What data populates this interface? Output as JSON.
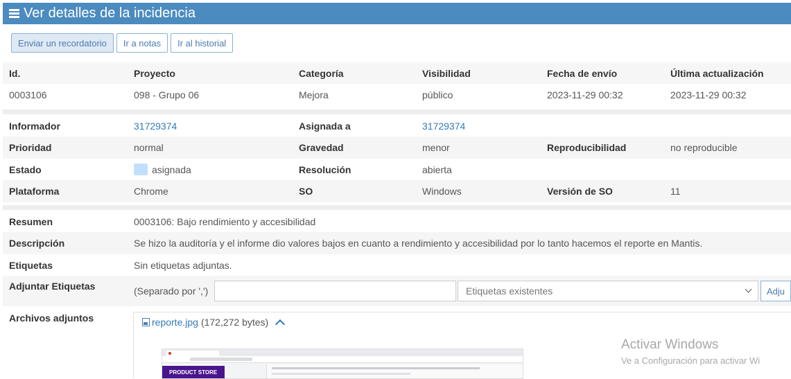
{
  "header": {
    "title": "Ver detalles de la incidencia"
  },
  "toolbar": {
    "reminder_label": "Enviar un recordatorio",
    "notes_label": "Ir a notas",
    "history_label": "Ir al historial"
  },
  "summary_table": {
    "headers": [
      "Id.",
      "Proyecto",
      "Categoría",
      "Visibilidad",
      "Fecha de envío",
      "Última actualización"
    ],
    "values": [
      "0003106",
      "098 - Grupo 06",
      "Mejora",
      "público",
      "2023-11-29 00:32",
      "2023-11-29 00:32"
    ]
  },
  "details": {
    "reporter_label": "Informador",
    "reporter_value": "31729374",
    "assigned_label": "Asignada a",
    "assigned_value": "31729374",
    "priority_label": "Prioridad",
    "priority_value": "normal",
    "severity_label": "Gravedad",
    "severity_value": "menor",
    "reproducibility_label": "Reproducibilidad",
    "reproducibility_value": "no reproducible",
    "status_label": "Estado",
    "status_value": "asignada",
    "resolution_label": "Resolución",
    "resolution_value": "abierta",
    "platform_label": "Plataforma",
    "platform_value": "Chrome",
    "os_label": "SO",
    "os_value": "Windows",
    "os_version_label": "Versión de SO",
    "os_version_value": "11"
  },
  "description": {
    "summary_label": "Resumen",
    "summary_value": "0003106: Bajo rendimiento y accesibilidad",
    "description_label": "Descripción",
    "description_value": "Se hizo la auditoría y el informe dio valores bajos en cuanto a rendimiento y accesibilidad por lo tanto hacemos el reporte en Mantis.",
    "tags_label": "Etiquetas",
    "tags_value": "Sin etiquetas adjuntas.",
    "attach_tags_label": "Adjuntar Etiquetas",
    "separator_hint": "(Separado por ',')",
    "existing_tags_placeholder": "Etiquetas existentes",
    "attach_button_label": "Adju"
  },
  "attachments": {
    "label": "Archivos adjuntos",
    "file_name": "reporte.jpg",
    "file_size": "(172,272 bytes)",
    "thumbnail_store_text": "PRODUCT STORE"
  },
  "watermark": {
    "title": "Activar Windows",
    "subtitle": "Ve a Configuración para activar Wi"
  },
  "colors": {
    "header_bg": "#4b8bbf",
    "link": "#337ab7",
    "status_badge": "#c2dfff"
  }
}
